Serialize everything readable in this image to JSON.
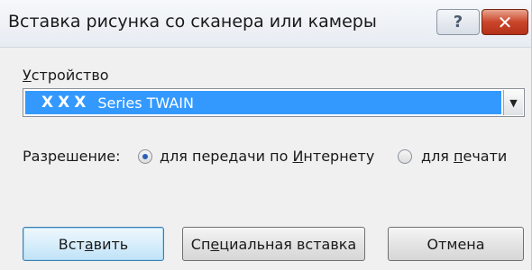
{
  "dialog": {
    "title": "Вставка рисунка со сканера или камеры",
    "help_glyph": "?",
    "close_glyph": "✕"
  },
  "device": {
    "label_underlined": "У",
    "label_rest": "стройство",
    "selected_prefix": "XXX",
    "selected_suffix": "Series TWAIN",
    "arrow_glyph": "▼"
  },
  "resolution": {
    "label": "Разрешение:",
    "options": [
      {
        "before": "для передачи по ",
        "underlined": "И",
        "after": "нтернету",
        "checked": true
      },
      {
        "before": "для ",
        "underlined": "п",
        "after": "ечати",
        "checked": false
      }
    ]
  },
  "buttons": {
    "insert": {
      "before": "Вст",
      "underlined": "а",
      "after": "вить"
    },
    "special": {
      "before": "Сп",
      "underlined": "е",
      "after": "циальная вставка"
    },
    "cancel": {
      "label": "Отмена"
    }
  }
}
